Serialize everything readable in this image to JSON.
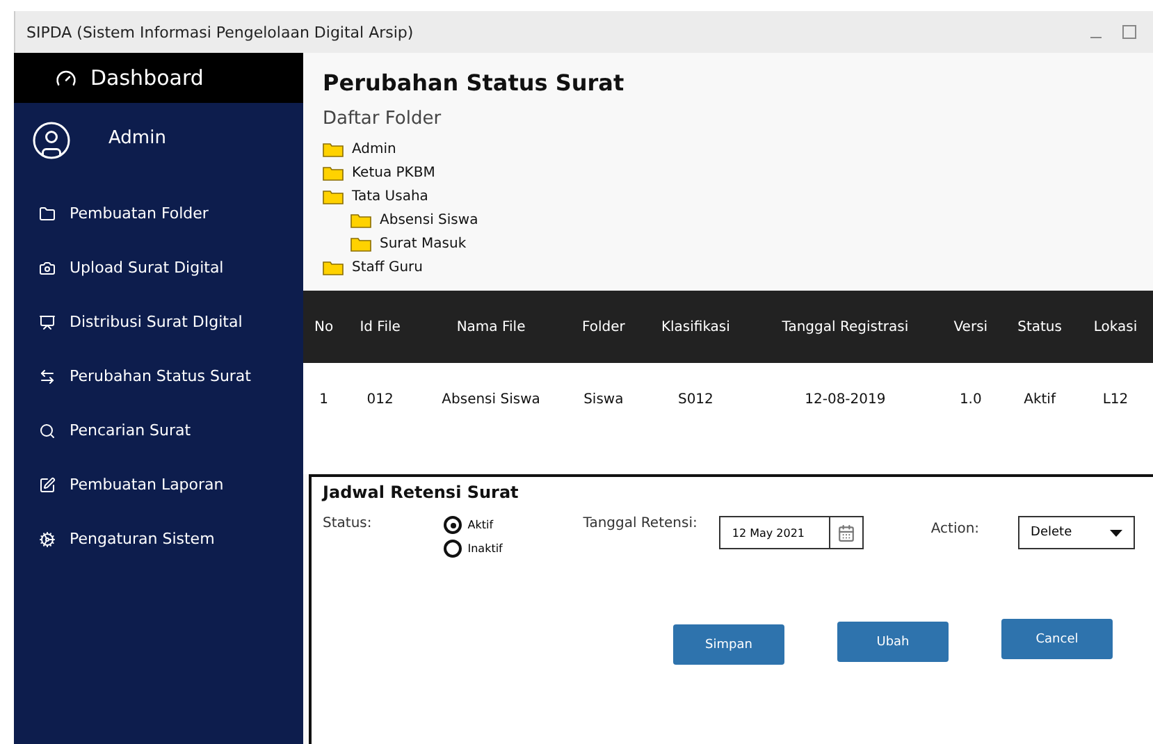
{
  "window": {
    "title": "SIPDA (Sistem Informasi Pengelolaan Digital Arsip)"
  },
  "sidebar": {
    "header": "Dashboard",
    "user": "Admin",
    "items": [
      {
        "label": "Pembuatan Folder"
      },
      {
        "label": "Upload Surat Digital"
      },
      {
        "label": "Distribusi Surat DIgital"
      },
      {
        "label": "Perubahan Status Surat"
      },
      {
        "label": "Pencarian Surat"
      },
      {
        "label": "Pembuatan Laporan"
      },
      {
        "label": "Pengaturan Sistem"
      }
    ]
  },
  "page": {
    "title": "Perubahan Status Surat",
    "folder_heading": "Daftar Folder",
    "folders": [
      {
        "name": "Admin"
      },
      {
        "name": "Ketua PKBM"
      },
      {
        "name": "Tata Usaha",
        "children": [
          {
            "name": "Absensi Siswa"
          },
          {
            "name": "Surat Masuk"
          }
        ]
      },
      {
        "name": "Staff Guru"
      }
    ]
  },
  "table": {
    "columns": [
      "No",
      "Id File",
      "Nama File",
      "Folder",
      "Klasifikasi",
      "Tanggal Registrasi",
      "Versi",
      "Status",
      "Lokasi"
    ],
    "rows": [
      [
        "1",
        "012",
        "Absensi Siswa",
        "Siswa",
        "S012",
        "12-08-2019",
        "1.0",
        "Aktif",
        "L12"
      ]
    ]
  },
  "retention": {
    "title": "Jadwal Retensi Surat",
    "status_label": "Status:",
    "options": [
      {
        "label": "Aktif",
        "selected": true
      },
      {
        "label": "Inaktif",
        "selected": false
      }
    ],
    "date_label": "Tanggal Retensi:",
    "date_value": "12 May 2021",
    "action_label": "Action:",
    "action_value": "Delete",
    "buttons": [
      "Simpan",
      "Ubah",
      "Cancel"
    ]
  }
}
